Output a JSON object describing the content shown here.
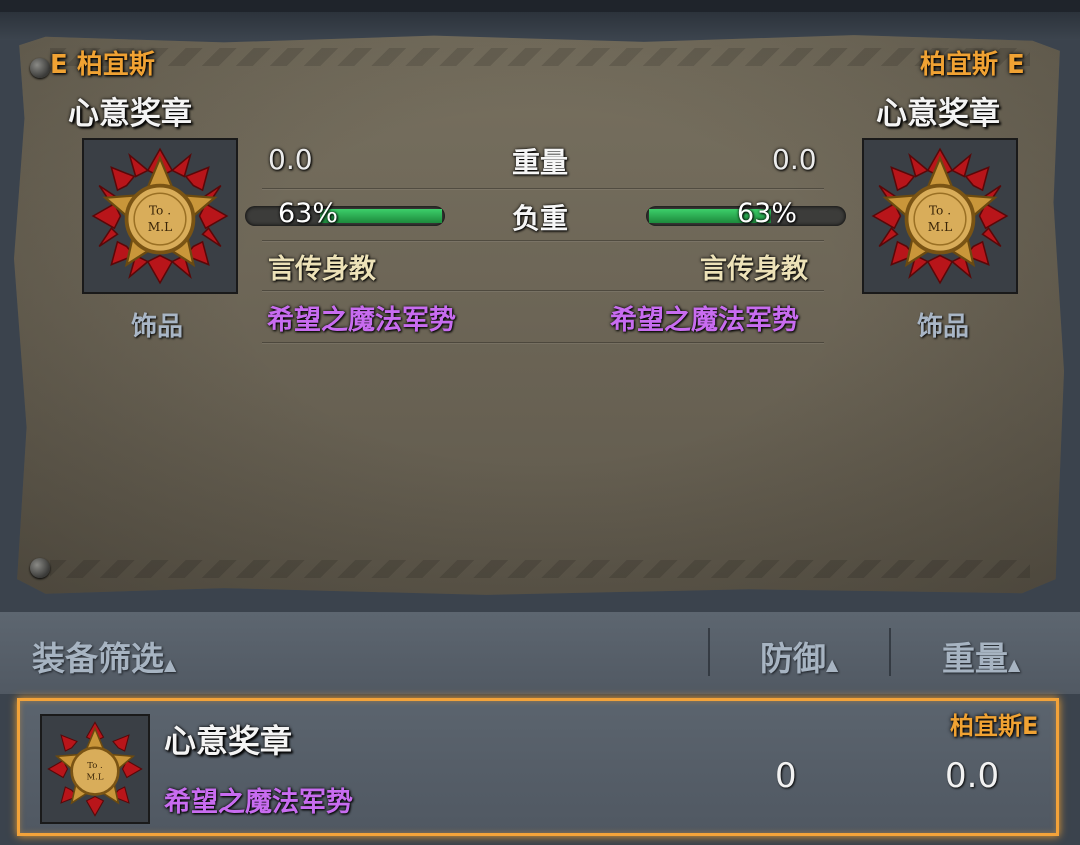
{
  "compare": {
    "left": {
      "owner": "E 柏宜斯",
      "item_name": "心意奖章",
      "category": "饰品",
      "weight": "0.0",
      "load_percent": "63%",
      "load_fraction": 0.63,
      "skill": "言传身教",
      "set_bonus": "希望之魔法军势"
    },
    "right": {
      "owner": "柏宜斯 E",
      "item_name": "心意奖章",
      "category": "饰品",
      "weight": "0.0",
      "load_percent": "63%",
      "load_fraction": 0.63,
      "skill": "言传身教",
      "set_bonus": "希望之魔法军势"
    },
    "labels": {
      "weight": "重量",
      "load": "负重"
    }
  },
  "filter_bar": {
    "filter_label": "装备筛选",
    "defense_label": "防御",
    "weight_label": "重量",
    "sort_icon": "triangle-up-icon"
  },
  "list": [
    {
      "name": "心意奖章",
      "set_bonus": "希望之魔法军势",
      "owner": "柏宜斯E",
      "defense": "0",
      "weight": "0.0"
    }
  ],
  "colors": {
    "owner": "#f0a233",
    "set_bonus": "#c86cf0",
    "selection_border": "#f3a33a",
    "load_bar": "#2ebd55"
  }
}
